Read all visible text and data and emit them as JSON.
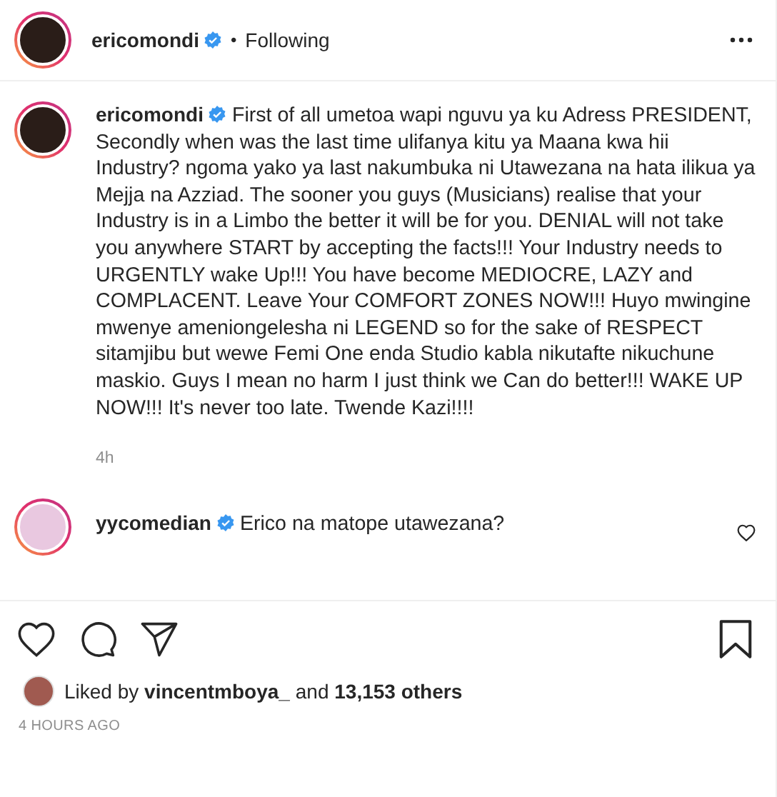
{
  "header": {
    "username": "ericomondi",
    "verified": true,
    "separator": "•",
    "follow_status": "Following"
  },
  "caption": {
    "username": "ericomondi",
    "verified": true,
    "text": "First of all umetoa wapi nguvu ya ku Adress PRESIDENT, Secondly when was the last time ulifanya kitu ya Maana kwa hii Industry? ngoma yako ya last nakumbuka ni Utawezana na hata ilikua ya Mejja na Azziad. The sooner you guys (Musicians) realise that your Industry is in a Limbo the better it will be for you. DENIAL will not take you anywhere START by accepting the facts!!! Your Industry needs to URGENTLY wake Up!!! You have become MEDIOCRE, LAZY and COMPLACENT. Leave Your COMFORT ZONES NOW!!! Huyo mwingine mwenye ameniongelesha ni LEGEND so for the sake of RESPECT sitamjibu but wewe Femi One enda Studio kabla nikutafte nikuchune maskio. Guys I mean no harm I just think we Can do better!!! WAKE UP NOW!!! It's never too late. Twende Kazi!!!!",
    "time": "4h"
  },
  "comments": [
    {
      "username": "yycomedian",
      "verified": true,
      "text": "Erico na matope utawezana?"
    }
  ],
  "likes": "Liked by **vincentmboya_** and **13,153 others**",
  "timestamp": "4 HOURS AGO"
}
